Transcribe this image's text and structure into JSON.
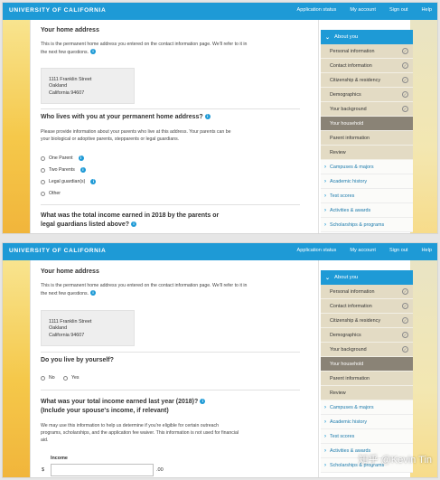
{
  "header": {
    "brand": "UNIVERSITY OF CALIFORNIA",
    "nav": [
      "Application status",
      "My account",
      "Sign out",
      "Help"
    ]
  },
  "colors": {
    "accent": "#1e9ad6",
    "sidebar_item": "#e3dbc4",
    "sidebar_active": "#8a8376"
  },
  "screen1": {
    "home_heading": "Your home address",
    "home_desc": "This is the permanent home address you entered on the contact information page. We'll refer to it in the next few questions.",
    "address": [
      "1111 Franklin Street",
      "Oakland",
      "California 94607"
    ],
    "lives_heading": "Who lives with you at your permanent home address?",
    "lives_desc": "Please provide information about your parents who live at this address. Your parents can be your biological or adoptive parents, stepparents or legal guardians.",
    "options": [
      "One Parent",
      "Two Parents",
      "Legal guardian(s)",
      "Other"
    ],
    "income_heading": "What was the total income earned in 2018 by the parents or legal guardians listed above?"
  },
  "screen2": {
    "home_heading": "Your home address",
    "home_desc": "This is the permanent home address you entered on the contact information page. We'll refer to it in the next few questions.",
    "address": [
      "1111 Franklin Street",
      "Oakland",
      "California 94607"
    ],
    "self_heading": "Do you live by yourself?",
    "options": [
      "No",
      "Yes"
    ],
    "income_heading_1": "What was your total income earned last year (2018)?",
    "income_heading_2": "(Include your spouse's income, if relevant)",
    "income_desc": "We may use this information to help us determine if you're eligible for certain outreach programs, scholarships, and the application fee waiver. This information is not used for financial aid.",
    "income_label": "Income",
    "currency": "$",
    "cents": ".00"
  },
  "sidebar": {
    "section": "About you",
    "items": [
      {
        "label": "Personal information",
        "state": "complete"
      },
      {
        "label": "Contact information",
        "state": "complete"
      },
      {
        "label": "Citizenship & residency",
        "state": "complete"
      },
      {
        "label": "Demographics",
        "state": "complete"
      },
      {
        "label": "Your background",
        "state": "complete"
      },
      {
        "label": "Your household",
        "state": "active"
      },
      {
        "label": "Parent information",
        "state": "pending"
      },
      {
        "label": "Review",
        "state": "pending"
      }
    ],
    "links": [
      "Campuses & majors",
      "Academic history",
      "Test scores",
      "Activities & awards",
      "Scholarships & programs"
    ]
  },
  "watermark": "知乎 @Kevin Tin"
}
